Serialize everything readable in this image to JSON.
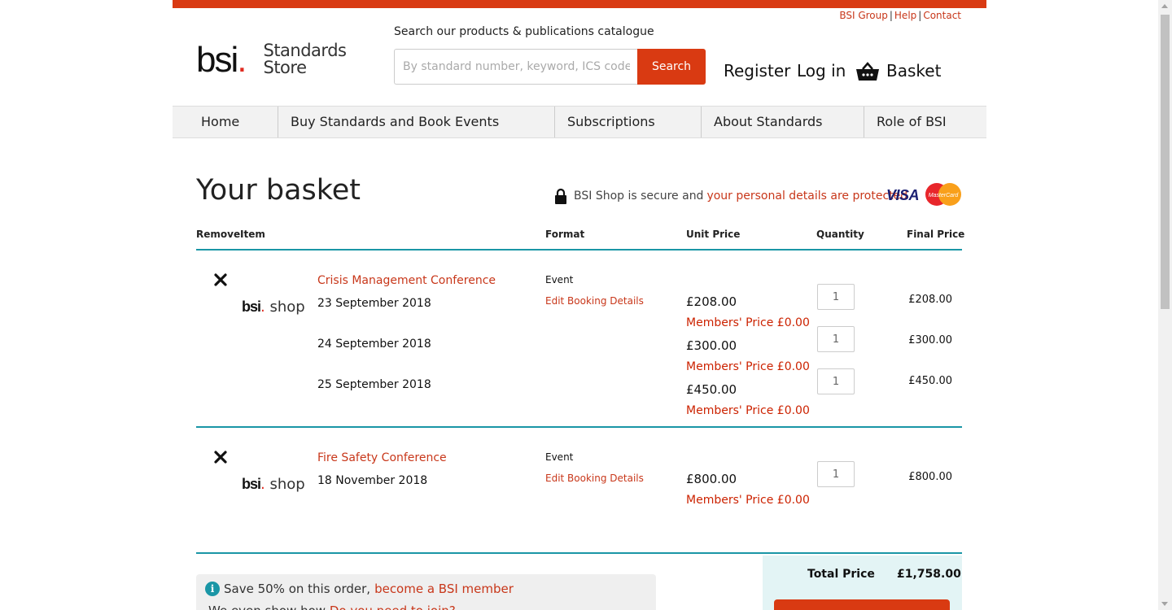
{
  "util_links": {
    "group": "BSI Group",
    "help": "Help",
    "contact": "Contact"
  },
  "logo": {
    "bsi": "bsi",
    "dot": ".",
    "store_line1": "Standards",
    "store_line2": "Store"
  },
  "search": {
    "label": "Search our products & publications catalogue",
    "placeholder": "By standard number, keyword, ICS code, ISBN",
    "button": "Search"
  },
  "account": {
    "register": "Register",
    "login": "Log in",
    "basket": "Basket"
  },
  "nav": [
    {
      "label": "Home"
    },
    {
      "label": "Buy Standards and Book Events"
    },
    {
      "label": "Subscriptions"
    },
    {
      "label": "About Standards"
    },
    {
      "label": "Role of BSI"
    }
  ],
  "page": {
    "title": "Your basket",
    "secure_text": "BSI Shop is secure and",
    "secure_link": "your personal details are protected",
    "visa": "VISA",
    "mastercard": "MasterCard"
  },
  "columns": {
    "remove": "Remove",
    "item": "Item",
    "format": "Format",
    "unit_price": "Unit Price",
    "quantity": "Quantity",
    "final_price": "Final Price"
  },
  "items": [
    {
      "title": "Crisis Management Conference",
      "format": "Event",
      "edit": "Edit Booking Details",
      "shop_bsi": "bsi",
      "shop_dot": ".",
      "shop_word": "shop",
      "dates": [
        {
          "date": "23 September 2018",
          "price": "£208.00",
          "member": "Members' Price £0.00",
          "qty": "1",
          "final": "£208.00"
        },
        {
          "date": "24 September 2018",
          "price": "£300.00",
          "member": "Members' Price £0.00",
          "qty": "1",
          "final": "£300.00"
        },
        {
          "date": "25 September 2018",
          "price": "£450.00",
          "member": "Members' Price £0.00",
          "qty": "1",
          "final": "£450.00"
        }
      ]
    },
    {
      "title": "Fire Safety Conference",
      "format": "Event",
      "edit": "Edit Booking Details",
      "shop_bsi": "bsi",
      "shop_dot": ".",
      "shop_word": "shop",
      "dates": [
        {
          "date": "18 November 2018",
          "price": "£800.00",
          "member": "Members' Price £0.00",
          "qty": "1",
          "final": "£800.00"
        }
      ]
    }
  ],
  "info": {
    "icon": "i",
    "save_text": "Save 50% on this order,",
    "save_link": "become a BSI member",
    "line2_text": "We even show how",
    "line2_link": "Do you need to join?"
  },
  "totals": {
    "label": "Total Price",
    "value": "£1,758.00"
  },
  "colors": {
    "accent": "#d93a12",
    "link": "#c8371a",
    "rule": "#1a96a6",
    "member": "#cc2200"
  }
}
